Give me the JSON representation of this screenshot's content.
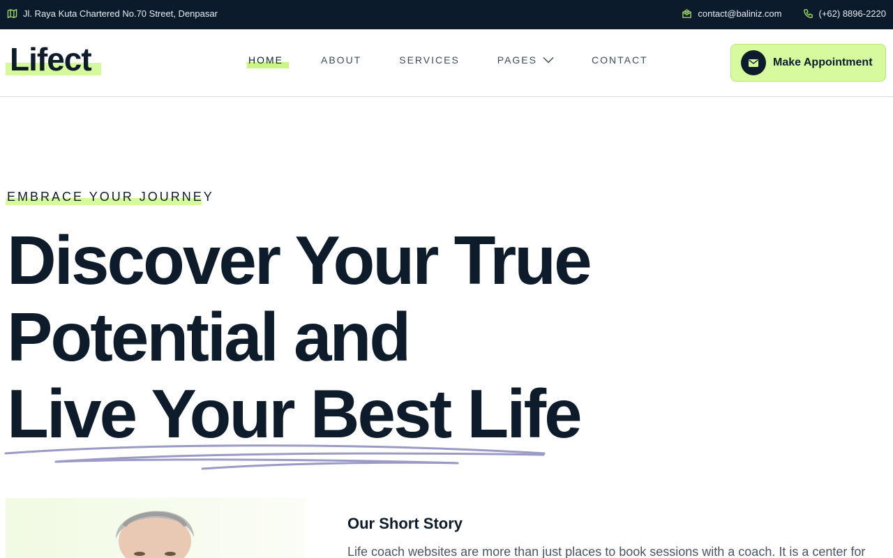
{
  "topbar": {
    "address": "Jl. Raya Kuta Chartered No.70 Street, Denpasar",
    "address_icon": "map-icon",
    "email": "contact@baliniz.com",
    "email_icon": "mail-icon",
    "phone": "(+62) 8896-2220",
    "phone_icon": "phone-icon"
  },
  "header": {
    "logo": "Lifect",
    "nav": [
      {
        "label": "HOME"
      },
      {
        "label": "ABOUT"
      },
      {
        "label": "SERVICES"
      },
      {
        "label": "PAGES"
      },
      {
        "label": "CONTACT"
      }
    ],
    "cta_label": "Make Appointment"
  },
  "hero": {
    "eyebrow": "EMBRACE YOUR JOURNEY",
    "line1": "Discover Your True",
    "line2": "Potential and",
    "line3": "Live Your Best Life"
  },
  "story": {
    "title": "Our Short Story",
    "text": "Life coach websites are more than just places to book sessions with a coach. It is a center for"
  },
  "colors": {
    "dark": "#0c1b2b",
    "accent": "#d6f99d",
    "scribble": "#9b9ac4"
  }
}
